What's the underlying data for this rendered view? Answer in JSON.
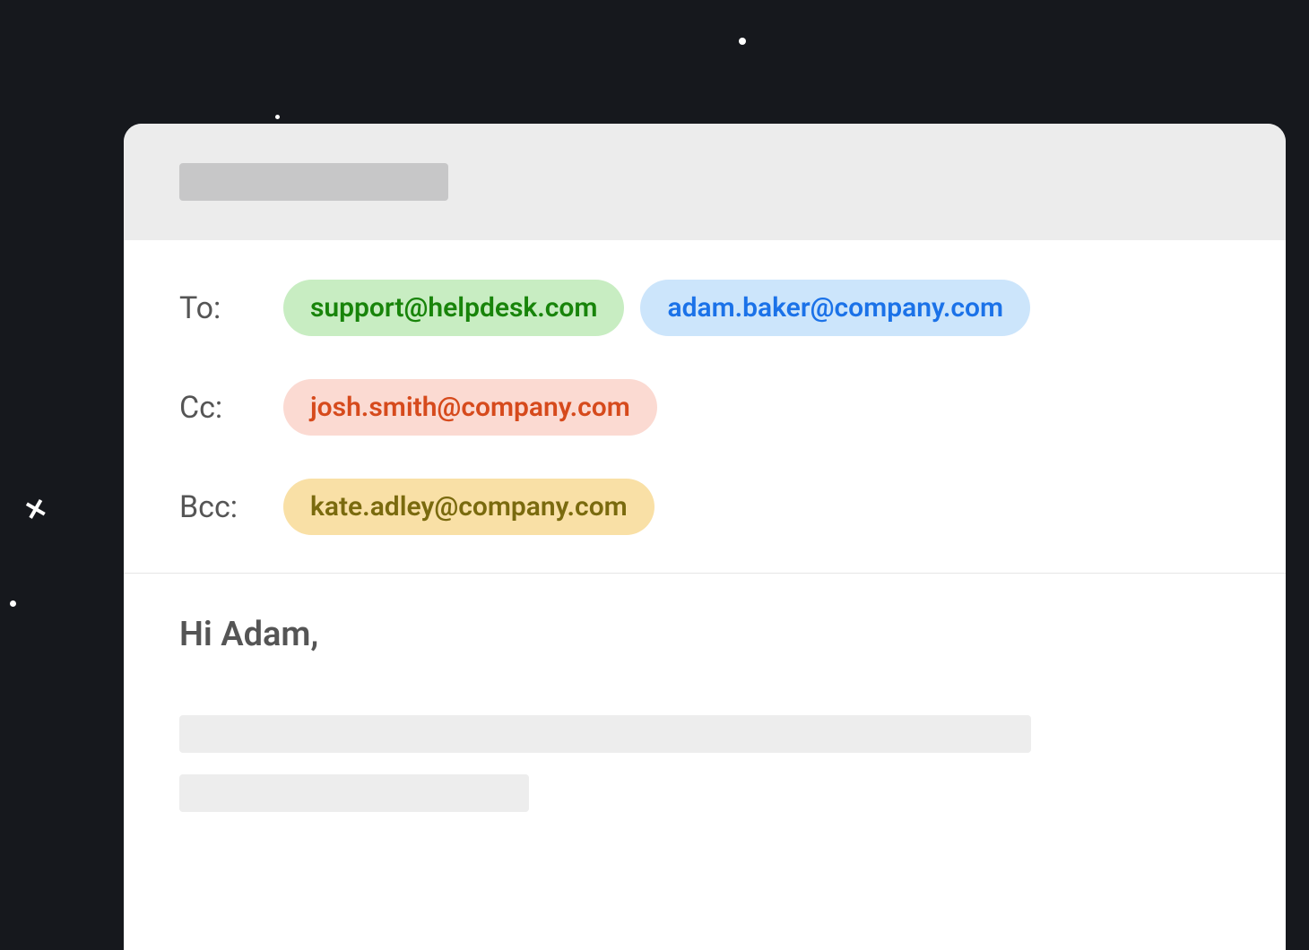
{
  "recipients": {
    "to_label": "To:",
    "cc_label": "Cc:",
    "bcc_label": "Bcc:",
    "to": [
      {
        "email": "support@helpdesk.com",
        "variant": "green"
      },
      {
        "email": "adam.baker@company.com",
        "variant": "blue"
      }
    ],
    "cc": [
      {
        "email": "josh.smith@company.com",
        "variant": "red"
      }
    ],
    "bcc": [
      {
        "email": "kate.adley@company.com",
        "variant": "yellow"
      }
    ]
  },
  "body": {
    "greeting": "Hi Adam,"
  }
}
